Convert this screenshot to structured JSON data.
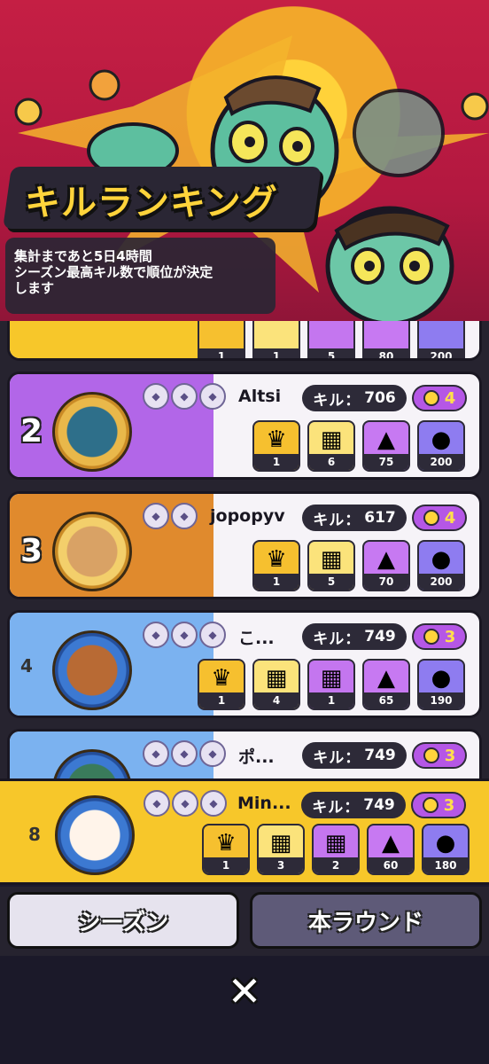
{
  "header": {
    "title": "キルランキング",
    "info_line1": "集計まであと5日4時間",
    "info_line2": "シーズン最高キル数で順位が決定",
    "info_line3": "します"
  },
  "kill_label": "キル：",
  "top_partial": {
    "rewards": [
      "1",
      "1",
      "5",
      "80",
      "200"
    ]
  },
  "rows": [
    {
      "rank": "2",
      "name": "Altsi",
      "kills": "706",
      "level": "4",
      "rewards": [
        "1",
        "6",
        "75",
        "200"
      ]
    },
    {
      "rank": "3",
      "name": "jopopyv",
      "kills": "617",
      "level": "4",
      "rewards": [
        "1",
        "5",
        "70",
        "200"
      ]
    },
    {
      "rank": "4",
      "name": "こ...",
      "kills": "749",
      "level": "3",
      "rewards": [
        "1",
        "4",
        "1",
        "65",
        "190"
      ]
    },
    {
      "rank": "",
      "name": "ポ...",
      "kills": "749",
      "level": "3",
      "rewards": []
    }
  ],
  "own": {
    "rank": "8",
    "name": "Min...",
    "kills": "749",
    "level": "3",
    "rewards": [
      "1",
      "3",
      "2",
      "60",
      "180"
    ]
  },
  "tabs": {
    "season": "シーズン",
    "round": "本ラウンド"
  },
  "close": "✕",
  "colors": {
    "header_red": "#c51f44",
    "gold": "#ffd43b",
    "purple": "#b557e6",
    "own_row": "#f7c72a"
  }
}
